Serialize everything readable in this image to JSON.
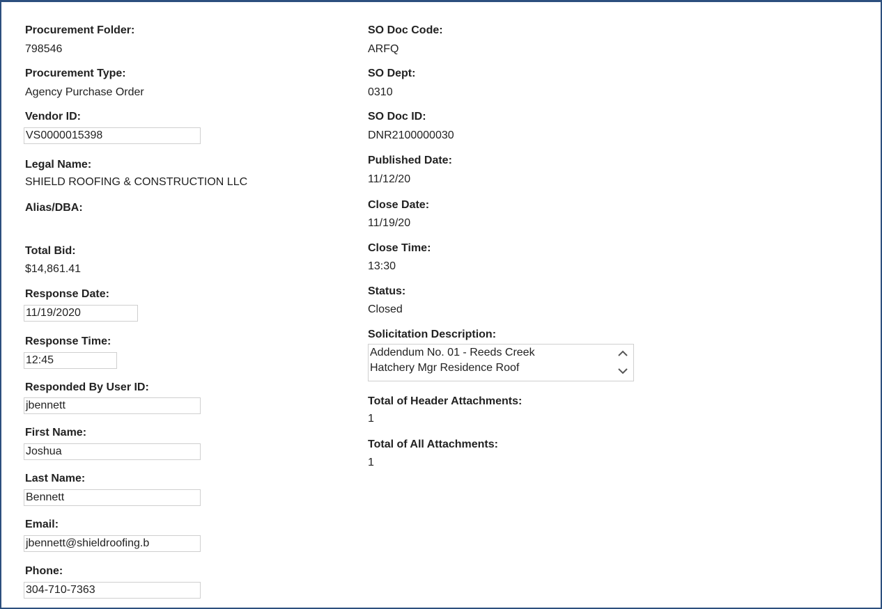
{
  "left": {
    "procurement_folder": {
      "label": "Procurement Folder:",
      "value": "798546"
    },
    "procurement_type": {
      "label": "Procurement Type:",
      "value": "Agency Purchase Order"
    },
    "vendor_id": {
      "label": "Vendor ID:",
      "value": "VS0000015398"
    },
    "legal_name": {
      "label": "Legal Name:",
      "value": "SHIELD ROOFING & CONSTRUCTION LLC"
    },
    "alias_dba": {
      "label": "Alias/DBA:",
      "value": ""
    },
    "total_bid": {
      "label": "Total Bid:",
      "value": "$14,861.41"
    },
    "response_date": {
      "label": "Response Date:",
      "value": "11/19/2020"
    },
    "response_time": {
      "label": "Response Time:",
      "value": "12:45"
    },
    "responded_by": {
      "label": "Responded By User ID:",
      "value": "jbennett"
    },
    "first_name": {
      "label": "First Name:",
      "value": "Joshua"
    },
    "last_name": {
      "label": "Last Name:",
      "value": "Bennett"
    },
    "email": {
      "label": "Email:",
      "value": "jbennett@shieldroofing.b"
    },
    "phone": {
      "label": "Phone:",
      "value": "304-710-7363"
    }
  },
  "right": {
    "so_doc_code": {
      "label": "SO Doc Code:",
      "value": "ARFQ"
    },
    "so_dept": {
      "label": "SO Dept:",
      "value": "0310"
    },
    "so_doc_id": {
      "label": "SO Doc ID:",
      "value": "DNR2100000030"
    },
    "published_date": {
      "label": "Published Date:",
      "value": "11/12/20"
    },
    "close_date": {
      "label": "Close Date:",
      "value": "11/19/20"
    },
    "close_time": {
      "label": "Close Time:",
      "value": "13:30"
    },
    "status": {
      "label": "Status:",
      "value": "Closed"
    },
    "solicitation_description": {
      "label": "Solicitation Description:",
      "line1": "Addendum No. 01 - Reeds Creek",
      "line2": "Hatchery Mgr Residence Roof"
    },
    "total_header_attachments": {
      "label": "Total of Header Attachments:",
      "value": "1"
    },
    "total_all_attachments": {
      "label": "Total of All Attachments:",
      "value": "1"
    }
  },
  "icons": {
    "scroll_up": "chevron-up-icon",
    "scroll_down": "chevron-down-icon"
  },
  "colors": {
    "frame_border": "#2c4f7e",
    "input_border": "#cfcfcf"
  }
}
